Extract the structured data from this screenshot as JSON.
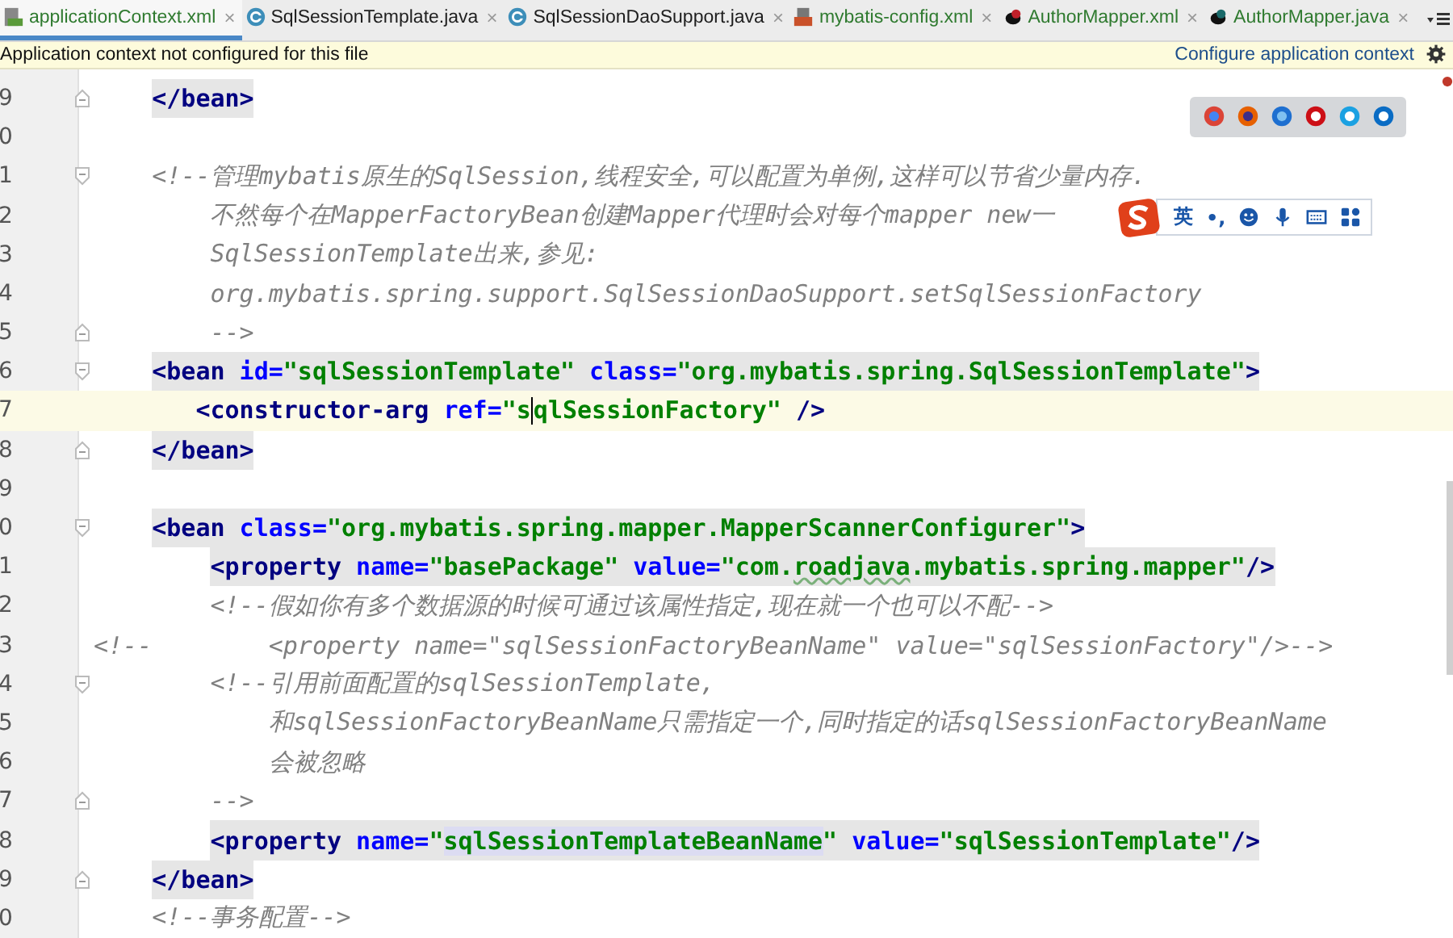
{
  "tabs": [
    {
      "label": "applicationContext.xml",
      "color": "#2f7a2f",
      "selected": true
    },
    {
      "label": "SqlSessionTemplate.java",
      "color": "#1e1e1e",
      "selected": false
    },
    {
      "label": "SqlSessionDaoSupport.java",
      "color": "#1e1e1e",
      "selected": false
    },
    {
      "label": "mybatis-config.xml",
      "color": "#2f7a2f",
      "selected": false
    },
    {
      "label": "AuthorMapper.xml",
      "color": "#2f7a2f",
      "selected": false
    },
    {
      "label": "AuthorMapper.java",
      "color": "#2f7a2f",
      "selected": false
    }
  ],
  "close_glyph": "×",
  "notification": {
    "message": "Application context not configured for this file",
    "link": "Configure application context"
  },
  "ime_toolbar": {
    "language": "英",
    "punctuation": "•,"
  },
  "lines": [
    {
      "number": "9",
      "fold_start": false,
      "fold_end": true,
      "highlighted": true,
      "current": false,
      "tokens": [
        {
          "kind": "tag",
          "text": "</bean>"
        }
      ]
    },
    {
      "number": "0",
      "fold_start": false,
      "fold_end": false,
      "current": false
    },
    {
      "number": "1",
      "fold_start": true,
      "fold_end": false,
      "highlighted": false,
      "current": false,
      "tokens": [
        {
          "kind": "comment",
          "text": "<!--管理mybatis原生的SqlSession,线程安全,可以配置为单例,这样可以节省少量内存."
        }
      ]
    },
    {
      "number": "2",
      "fold_start": false,
      "fold_end": false,
      "highlighted": false,
      "current": false,
      "tokens": [
        {
          "kind": "comment",
          "text": "不然每个在MapperFactoryBean创建Mapper代理时会对每个mapper new一"
        }
      ]
    },
    {
      "number": "3",
      "fold_start": false,
      "fold_end": false,
      "highlighted": false,
      "current": false,
      "tokens": [
        {
          "kind": "comment",
          "text": "SqlSessionTemplate出来,参见:"
        }
      ]
    },
    {
      "number": "4",
      "fold_start": false,
      "fold_end": false,
      "highlighted": false,
      "current": false,
      "tokens": [
        {
          "kind": "comment",
          "text": "org.mybatis.spring.support.SqlSessionDaoSupport.setSqlSessionFactory"
        }
      ]
    },
    {
      "number": "5",
      "fold_start": false,
      "fold_end": true,
      "highlighted": false,
      "current": false,
      "tokens": [
        {
          "kind": "comment",
          "text": "-->"
        }
      ]
    },
    {
      "number": "6",
      "fold_start": true,
      "fold_end": false,
      "highlighted": true,
      "current": false,
      "tokens": [
        {
          "kind": "tag",
          "text": "<bean "
        },
        {
          "kind": "attr",
          "text": "id="
        },
        {
          "kind": "value",
          "text": "\"sqlSessionTemplate\" "
        },
        {
          "kind": "attr",
          "text": "class="
        },
        {
          "kind": "value",
          "text": "\"org.mybatis.spring.SqlSessionTemplate\""
        },
        {
          "kind": "tag",
          "text": ">"
        }
      ]
    },
    {
      "number": "7",
      "fold_start": false,
      "fold_end": false,
      "highlighted": false,
      "current": true,
      "tokens": [
        {
          "kind": "tag",
          "text": "<constructor-arg "
        },
        {
          "kind": "attr",
          "text": "ref="
        },
        {
          "kind": "value",
          "text": "\"s",
          "caret": true
        },
        {
          "kind": "value",
          "text": "qlSessionFactory\" "
        },
        {
          "kind": "tag",
          "text": "/>"
        }
      ]
    },
    {
      "number": "8",
      "fold_start": false,
      "fold_end": true,
      "highlighted": true,
      "current": false,
      "tokens": [
        {
          "kind": "tag",
          "text": "</bean>"
        }
      ]
    },
    {
      "number": "9",
      "fold_start": false,
      "fold_end": false,
      "current": false
    },
    {
      "number": "0",
      "fold_start": true,
      "fold_end": false,
      "highlighted": true,
      "current": false,
      "tokens": [
        {
          "kind": "tag",
          "text": "<bean "
        },
        {
          "kind": "attr",
          "text": "class="
        },
        {
          "kind": "value",
          "text": "\"org.mybatis.spring.mapper.MapperScannerConfigurer\""
        },
        {
          "kind": "tag",
          "text": ">"
        }
      ]
    },
    {
      "number": "1",
      "fold_start": false,
      "fold_end": false,
      "highlighted": true,
      "current": false,
      "tokens": [
        {
          "kind": "tag",
          "text": "<property "
        },
        {
          "kind": "attr",
          "text": "name="
        },
        {
          "kind": "value",
          "text": "\"basePackage\" "
        },
        {
          "kind": "attr",
          "text": "value="
        },
        {
          "kind": "value",
          "text": "\"com."
        },
        {
          "kind": "value",
          "text": "roadjava",
          "typo": true
        },
        {
          "kind": "value",
          "text": ".mybatis.spring.mapper\""
        },
        {
          "kind": "tag",
          "text": "/>"
        }
      ]
    },
    {
      "number": "2",
      "fold_start": false,
      "fold_end": false,
      "highlighted": false,
      "current": false,
      "tokens": [
        {
          "kind": "comment",
          "text": "<!--假如你有多个数据源的时候可通过该属性指定,现在就一个也可以不配-->"
        }
      ]
    },
    {
      "number": "3",
      "fold_start": false,
      "fold_end": false,
      "highlighted": false,
      "current": false,
      "tokens": [
        {
          "kind": "comment",
          "text": "<!--        <property name=\"sqlSessionFactoryBeanName\" value=\"sqlSessionFactory\"/>-->"
        }
      ]
    },
    {
      "number": "4",
      "fold_start": true,
      "fold_end": false,
      "highlighted": false,
      "current": false,
      "tokens": [
        {
          "kind": "comment",
          "text": "<!--引用前面配置的sqlSessionTemplate,"
        }
      ]
    },
    {
      "number": "5",
      "fold_start": false,
      "fold_end": false,
      "highlighted": false,
      "current": false,
      "tokens": [
        {
          "kind": "comment",
          "text": "和sqlSessionFactoryBeanName只需指定一个,同时指定的话sqlSessionFactoryBeanName"
        }
      ]
    },
    {
      "number": "6",
      "fold_start": false,
      "fold_end": false,
      "highlighted": false,
      "current": false,
      "tokens": [
        {
          "kind": "comment",
          "text": "会被忽略"
        }
      ]
    },
    {
      "number": "7",
      "fold_start": false,
      "fold_end": true,
      "highlighted": false,
      "current": false,
      "tokens": [
        {
          "kind": "comment",
          "text": "-->"
        }
      ]
    },
    {
      "number": "8",
      "fold_start": false,
      "fold_end": false,
      "highlighted": true,
      "current": false,
      "tokens": [
        {
          "kind": "tag",
          "text": "<property "
        },
        {
          "kind": "attr",
          "text": "name="
        },
        {
          "kind": "value",
          "text": "\""
        },
        {
          "kind": "value",
          "text": "sqlSessionTemplateBeanName",
          "marked": true
        },
        {
          "kind": "value",
          "text": "\" "
        },
        {
          "kind": "attr",
          "text": "value="
        },
        {
          "kind": "value",
          "text": "\"sqlSessionTemplate\""
        },
        {
          "kind": "tag",
          "text": "/>"
        }
      ]
    },
    {
      "number": "9",
      "fold_start": false,
      "fold_end": true,
      "highlighted": true,
      "current": false,
      "tokens": [
        {
          "kind": "tag",
          "text": "</bean>"
        }
      ]
    },
    {
      "number": "0",
      "fold_start": false,
      "fold_end": false,
      "highlighted": false,
      "current": false,
      "tokens": [
        {
          "kind": "comment",
          "text": "<!--事务配置-->"
        }
      ]
    }
  ]
}
